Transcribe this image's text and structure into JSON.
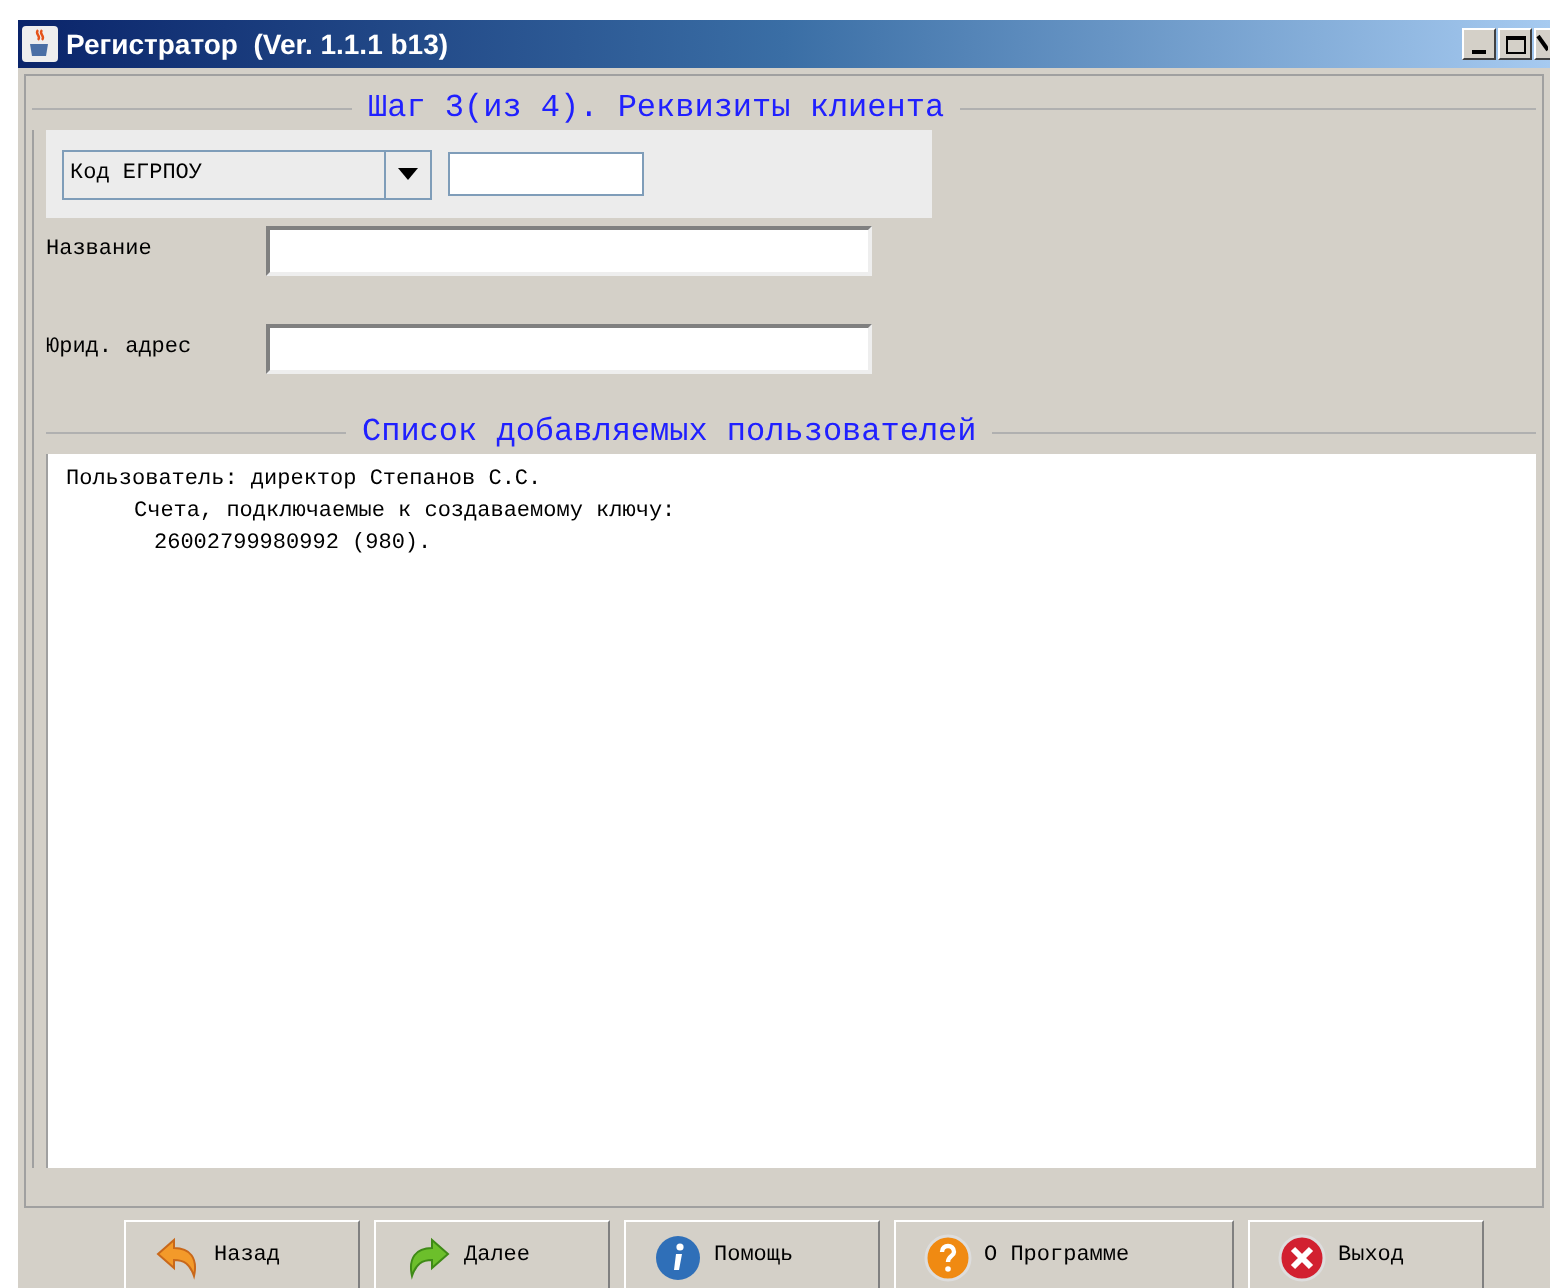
{
  "window": {
    "title": "Регистратор  (Ver. 1.1.1 b13)"
  },
  "step_title": "Шаг 3(из 4). Реквизиты клиента",
  "code": {
    "selector": "Код ЕГРПОУ"
  },
  "fields": [
    {
      "label": "Название"
    },
    {
      "label": "Юрид. адрес"
    }
  ],
  "users": {
    "title": "Список добавляемых пользователей",
    "lines": [
      {
        "text": "Пользователь: директор Степанов С.С.",
        "children": [
          {
            "text": "Счета, подключаемые к создаваемому ключу:",
            "children": [
              {
                "text": "26002799980992 (980)."
              }
            ]
          }
        ]
      }
    ]
  },
  "buttons": [
    {
      "label": "Назад",
      "kind": "back"
    },
    {
      "label": "Далее",
      "kind": "next"
    },
    {
      "label": "Помощь",
      "kind": "info"
    },
    {
      "label": "О Программе",
      "kind": "about"
    },
    {
      "label": "Выход",
      "kind": "exit"
    }
  ]
}
